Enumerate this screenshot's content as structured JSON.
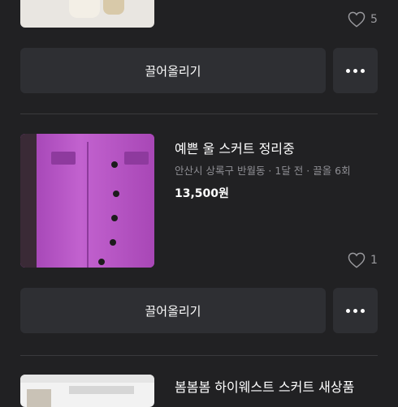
{
  "items": [
    {
      "likes": "5",
      "bump_label": "끌어올리기"
    },
    {
      "title": "예쁜 울 스커트 정리중",
      "meta": "안산시 상록구 반월동 · 1달 전 · 끌올 6회",
      "price": "13,500원",
      "likes": "1",
      "bump_label": "끌어올리기"
    },
    {
      "title": "봄봄봄 하이웨스트 스커트 새상품"
    }
  ],
  "icons": {
    "like": "heart-icon",
    "more": "more-horizontal-icon"
  },
  "colors": {
    "background": "#212123",
    "button": "#2e2f33",
    "meta_text": "#8e8e93"
  }
}
